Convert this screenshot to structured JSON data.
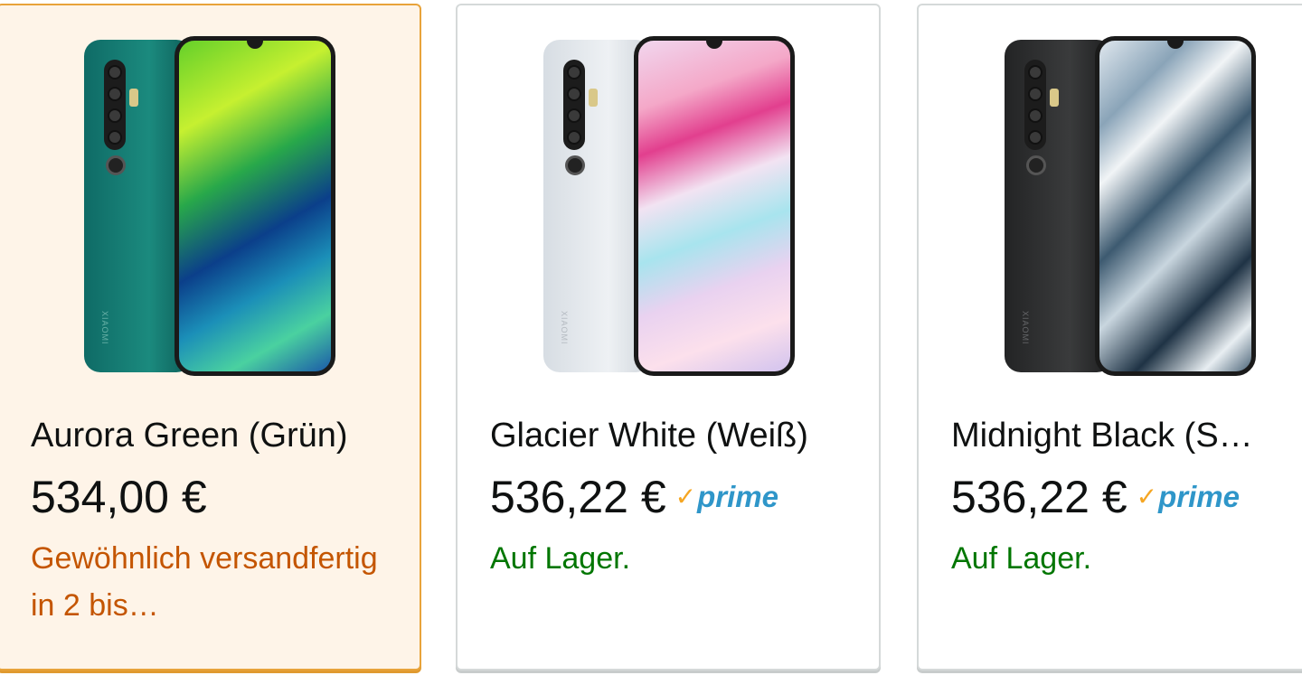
{
  "colors": {
    "selected_border": "#e8a33a",
    "selected_background": "#fef4e8",
    "in_stock": "#007600",
    "delayed": "#c45500",
    "prime_blue": "#2f96c9",
    "prime_check": "#f5a623"
  },
  "variants": [
    {
      "title": "Aurora Green (Grün)",
      "price": "534,00 €",
      "prime": false,
      "availability": "Gewöhnlich versandfertig in 2 bis…",
      "availability_status": "delayed",
      "selected": true,
      "phone_brand": "XIAOMI"
    },
    {
      "title": "Glacier White (Weiß)",
      "price": "536,22 €",
      "prime": true,
      "prime_label": "prime",
      "availability": "Auf Lager.",
      "availability_status": "instock",
      "selected": false,
      "phone_brand": "XIAOMI"
    },
    {
      "title": "Midnight Black (S…",
      "price": "536,22 €",
      "prime": true,
      "prime_label": "prime",
      "availability": "Auf Lager.",
      "availability_status": "instock",
      "selected": false,
      "phone_brand": "XIAOMI"
    }
  ]
}
